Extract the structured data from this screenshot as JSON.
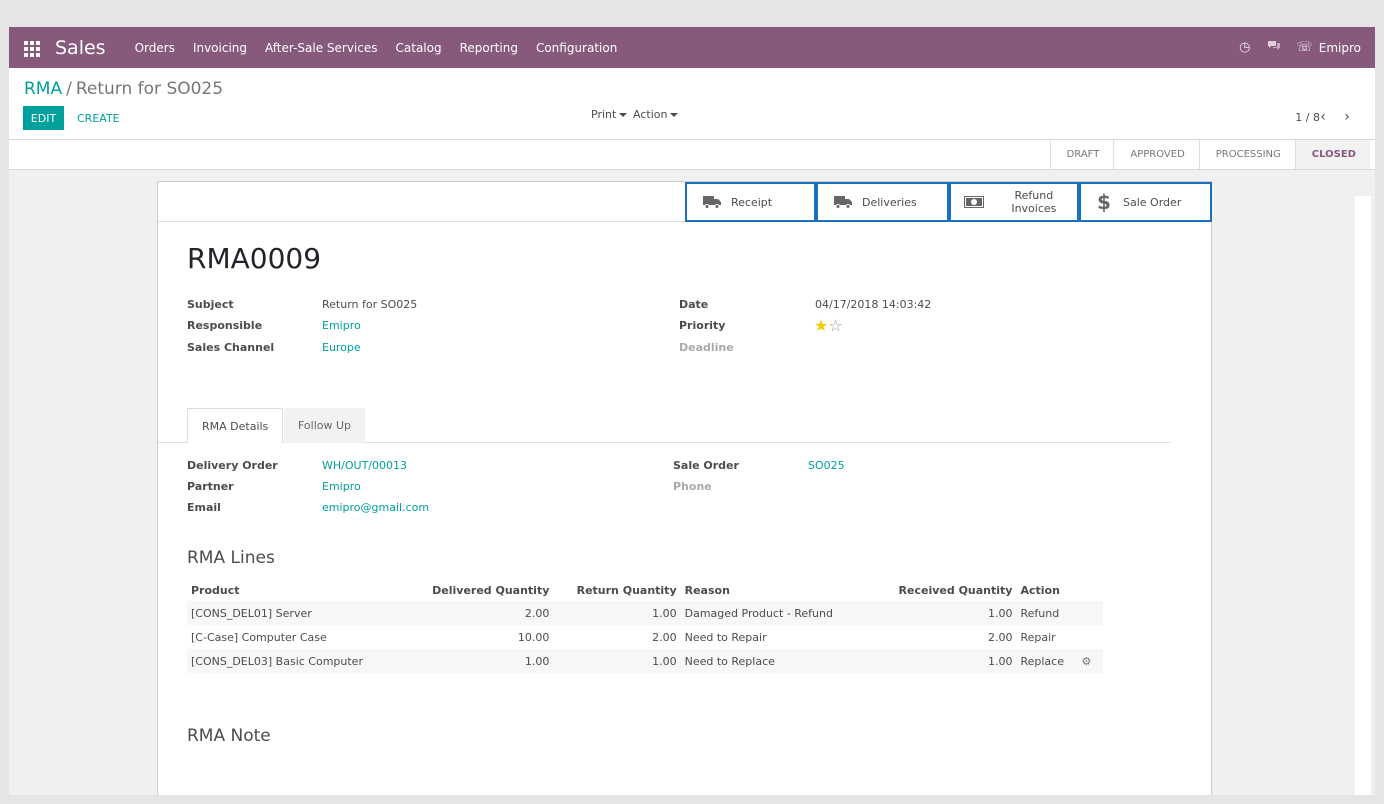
{
  "navbar": {
    "brand": "Sales",
    "menu": [
      "Orders",
      "Invoicing",
      "After-Sale Services",
      "Catalog",
      "Reporting",
      "Configuration"
    ],
    "user": "Emipro"
  },
  "breadcrumb": {
    "parent": "RMA",
    "separator": "/",
    "current": "Return for SO025"
  },
  "toolbar": {
    "edit_label": "EDIT",
    "create_label": "CREATE",
    "print_label": "Print",
    "action_label": "Action"
  },
  "pager": {
    "text": "1 / 8"
  },
  "stages": [
    "DRAFT",
    "APPROVED",
    "PROCESSING",
    "CLOSED"
  ],
  "active_stage": "CLOSED",
  "smart_buttons": [
    {
      "label": "Receipt",
      "icon": "truck-icon"
    },
    {
      "label": "Deliveries",
      "icon": "truck-icon"
    },
    {
      "label": "Refund Invoices",
      "icon": "money-icon"
    },
    {
      "label": "Sale Order",
      "icon": "dollar-icon"
    }
  ],
  "record": {
    "name": "RMA0009",
    "left_fields": [
      {
        "label": "Subject",
        "value": "Return for SO025",
        "link": false
      },
      {
        "label": "Responsible",
        "value": "Emipro",
        "link": true
      },
      {
        "label": "Sales Channel",
        "value": "Europe",
        "link": true
      }
    ],
    "right_fields": [
      {
        "label": "Date",
        "value": "04/17/2018 14:03:42"
      },
      {
        "label": "Priority",
        "value": ""
      },
      {
        "label": "Deadline",
        "value": ""
      }
    ],
    "priority_stars": {
      "filled": 1,
      "total": 2
    }
  },
  "tabs": [
    "RMA Details",
    "Follow Up"
  ],
  "details": {
    "left": [
      {
        "label": "Delivery Order",
        "value": "WH/OUT/00013"
      },
      {
        "label": "Partner",
        "value": "Emipro"
      },
      {
        "label": "Email",
        "value": "emipro@gmail.com"
      }
    ],
    "right": [
      {
        "label": "Sale Order",
        "value": "SO025"
      },
      {
        "label": "Phone",
        "value": ""
      }
    ]
  },
  "rma_lines": {
    "title": "RMA Lines",
    "columns": [
      "Product",
      "Delivered Quantity",
      "Return Quantity",
      "Reason",
      "Received Quantity",
      "Action"
    ],
    "rows": [
      [
        "[CONS_DEL01] Server",
        "2.00",
        "1.00",
        "Damaged Product - Refund",
        "1.00",
        "Refund"
      ],
      [
        "[C-Case] Computer Case",
        "10.00",
        "2.00",
        "Need to Repair",
        "2.00",
        "Repair"
      ],
      [
        "[CONS_DEL03] Basic Computer",
        "1.00",
        "1.00",
        "Need to Replace",
        "1.00",
        "Replace"
      ]
    ]
  },
  "rma_note_title": "RMA Note",
  "colors": {
    "brand": "#875a7b",
    "accent": "#00a09d",
    "highlight": "#1a6fc0"
  }
}
